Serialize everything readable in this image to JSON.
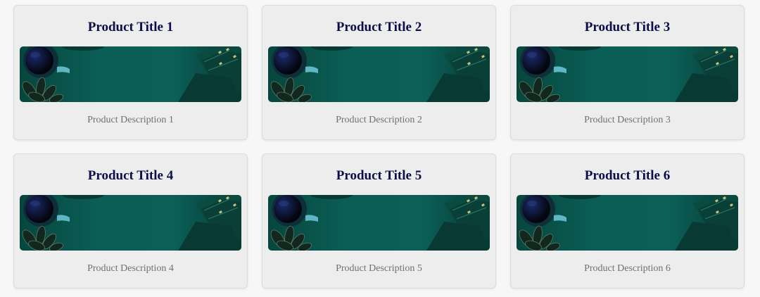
{
  "products": [
    {
      "title": "Product Title 1",
      "description": "Product Description 1"
    },
    {
      "title": "Product Title 2",
      "description": "Product Description 2"
    },
    {
      "title": "Product Title 3",
      "description": "Product Description 3"
    },
    {
      "title": "Product Title 4",
      "description": "Product Description 4"
    },
    {
      "title": "Product Title 5",
      "description": "Product Description 5"
    },
    {
      "title": "Product Title 6",
      "description": "Product Description 6"
    }
  ],
  "colors": {
    "title": "#0d0d4a",
    "description": "#707070",
    "card_background": "#ededed",
    "image_teal": "#0a5a52"
  },
  "image_icon": "coffee-desk-photo"
}
